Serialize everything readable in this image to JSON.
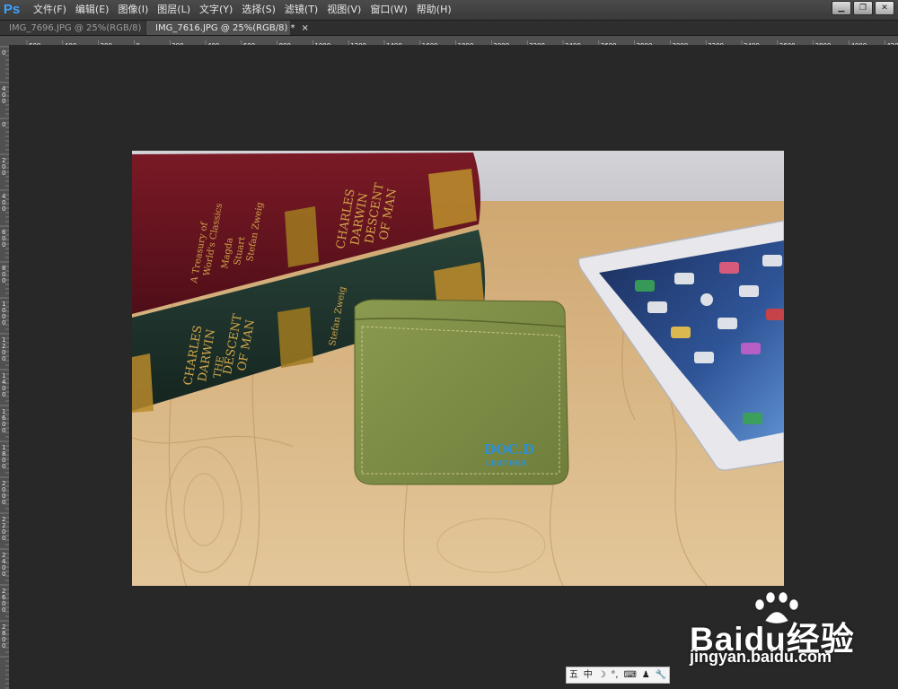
{
  "app": {
    "logo": "Ps"
  },
  "menu": [
    "文件(F)",
    "编辑(E)",
    "图像(I)",
    "图层(L)",
    "文字(Y)",
    "选择(S)",
    "滤镜(T)",
    "视图(V)",
    "窗口(W)",
    "帮助(H)"
  ],
  "window_controls": {
    "minimize": "▁",
    "restore": "❐",
    "close": "✕"
  },
  "tabs": [
    {
      "label": "IMG_7696.JPG @ 25%(RGB/8)",
      "close": "×",
      "active": false
    },
    {
      "label": "IMG_7616.JPG @ 25%(RGB/8) *",
      "close": "×",
      "active": true
    }
  ],
  "ruler_h_labels": [
    "600",
    "400",
    "200",
    "0",
    "200",
    "400",
    "600",
    "800",
    "1000",
    "1200",
    "1400",
    "1600",
    "1800",
    "2000",
    "2200",
    "2400",
    "2600",
    "2800",
    "3000",
    "3200",
    "3400",
    "3600",
    "3800",
    "4000",
    "420"
  ],
  "ruler_v_labels": [
    "0",
    "400",
    "0",
    "200",
    "400",
    "600",
    "800",
    "1000",
    "1200",
    "1400",
    "1600",
    "1800",
    "2000",
    "2200",
    "2400",
    "2600",
    "2800"
  ],
  "photo": {
    "book_top": {
      "lines": [
        "A Treasury of",
        "World's Classics",
        "Magda",
        "Stuart",
        "Stefan Zweig",
        "CHARLES",
        "DARWIN",
        "DESCENT",
        "OF MAN"
      ]
    },
    "book_bottom": {
      "lines": [
        "CHARLES",
        "DARWIN",
        "THE",
        "DESCENT",
        "OF MAN",
        "Stefan Zweig"
      ]
    },
    "wallet": {
      "brand": "DOC.D",
      "sub": "LEATHER"
    }
  },
  "ime_bar": [
    "五",
    "中",
    "☽",
    "°,",
    "⌨",
    "♟",
    "🔧"
  ],
  "watermark": {
    "brand": "Baidu经验",
    "url": "jingyan.baidu.com"
  },
  "colors": {
    "accent": "#3da3ff",
    "bg": "#282828",
    "ruler": "#505050"
  }
}
